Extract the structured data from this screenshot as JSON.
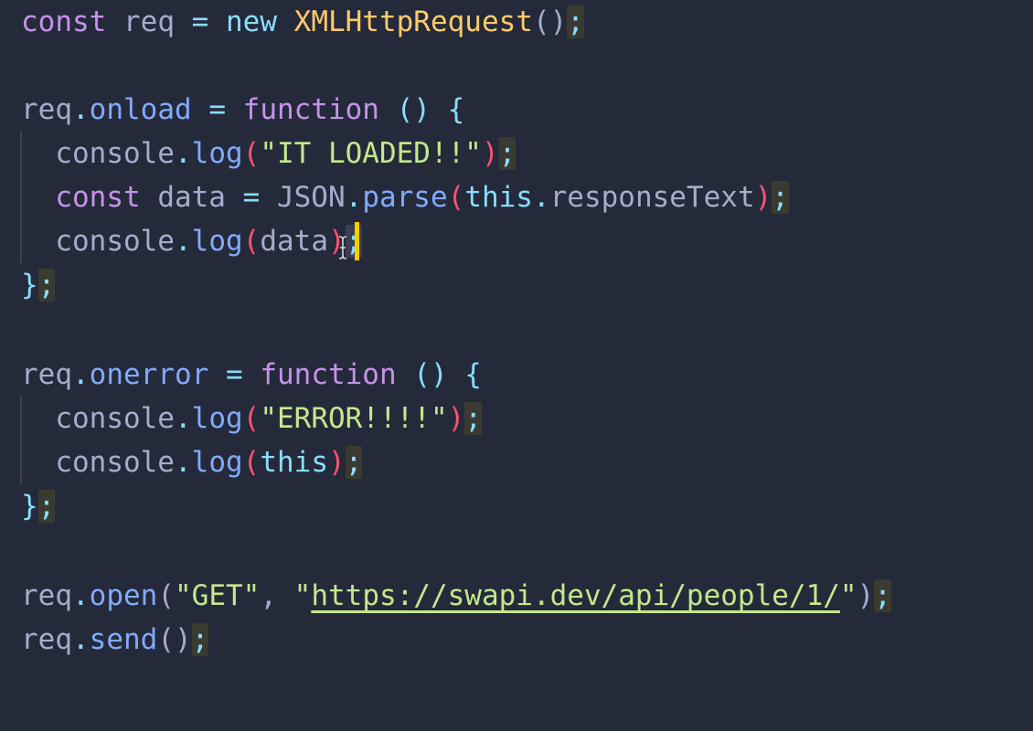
{
  "colors": {
    "background": "#252a3a",
    "keyword": "#c792ea",
    "function": "#82aaff",
    "class": "#ffcb6b",
    "string": "#c3e88d",
    "punctuation": "#89ddff",
    "variable": "#a6accd",
    "paren_highlight": "#ff5370",
    "cursor": "#ffcc00"
  },
  "cursor_icon": "text-cursor-icon",
  "code": {
    "l1": {
      "kw": "const",
      "v": " req ",
      "op": "=",
      "new": " new ",
      "cls": "XMLHttpRequest",
      "paren": "()",
      "semi": ";"
    },
    "l3": {
      "obj": "req",
      "dot": ".",
      "prop": "onload",
      "op": " = ",
      "kw": "function",
      "sig": " () {"
    },
    "l4": {
      "obj": "console",
      "dot": ".",
      "fn": "log",
      "po": "(",
      "str": "\"IT LOADED!!\"",
      "pc": ")",
      "semi": ";"
    },
    "l5": {
      "kw": "const",
      "v": " data ",
      "op": "=",
      "json": " JSON",
      "dot": ".",
      "fn": "parse",
      "po": "(",
      "this": "this",
      "dot2": ".",
      "prop": "responseText",
      "pc": ")",
      "semi": ";"
    },
    "l6": {
      "obj": "console",
      "dot": ".",
      "fn": "log",
      "po": "(",
      "arg": "data",
      "pc": ")",
      "semi": ";"
    },
    "l7": {
      "brace": "}",
      "semi": ";"
    },
    "l9": {
      "obj": "req",
      "dot": ".",
      "prop": "onerror",
      "op": " = ",
      "kw": "function",
      "sig": " () {"
    },
    "l10": {
      "obj": "console",
      "dot": ".",
      "fn": "log",
      "po": "(",
      "str": "\"ERROR!!!!\"",
      "pc": ")",
      "semi": ";"
    },
    "l11": {
      "obj": "console",
      "dot": ".",
      "fn": "log",
      "po": "(",
      "this": "this",
      "pc": ")",
      "semi": ";"
    },
    "l12": {
      "brace": "}",
      "semi": ";"
    },
    "l14": {
      "obj": "req",
      "dot": ".",
      "fn": "open",
      "po": "(",
      "str1": "\"GET\"",
      "comma": ", ",
      "q1": "\"",
      "url": "https://swapi.dev/api/people/1/",
      "q2": "\"",
      "pc": ")",
      "semi": ";"
    },
    "l15": {
      "obj": "req",
      "dot": ".",
      "fn": "send",
      "paren": "()",
      "semi": ";"
    }
  }
}
